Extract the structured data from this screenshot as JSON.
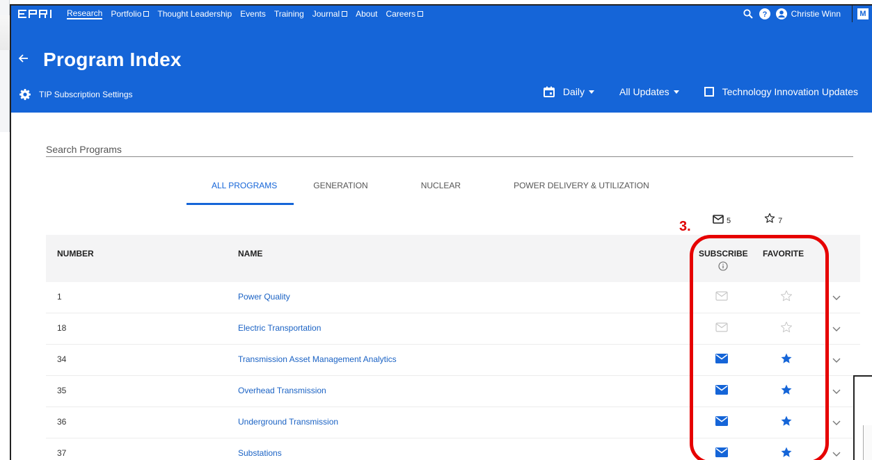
{
  "colors": {
    "brand": "#1565d8",
    "link": "#1a62c4",
    "annotation": "#e60000"
  },
  "nav": {
    "items": [
      {
        "label": "Research",
        "external": false,
        "active": true
      },
      {
        "label": "Portfolio",
        "external": true,
        "active": false
      },
      {
        "label": "Thought Leadership",
        "external": false,
        "active": false
      },
      {
        "label": "Events",
        "external": false,
        "active": false
      },
      {
        "label": "Training",
        "external": false,
        "active": false
      },
      {
        "label": "Journal",
        "external": true,
        "active": false
      },
      {
        "label": "About",
        "external": false,
        "active": false
      },
      {
        "label": "Careers",
        "external": true,
        "active": false
      }
    ],
    "user_name": "Christie Winn",
    "avatar_letter": "M"
  },
  "header": {
    "title": "Program Index",
    "tip_settings": "TIP Subscription Settings",
    "frequency": "Daily",
    "updates": "All Updates",
    "tech_updates": "Technology Innovation Updates"
  },
  "search": {
    "placeholder": "Search Programs"
  },
  "tabs": [
    {
      "label": "ALL PROGRAMS",
      "active": true
    },
    {
      "label": "GENERATION",
      "active": false
    },
    {
      "label": "NUCLEAR",
      "active": false
    },
    {
      "label": "POWER DELIVERY & UTILIZATION",
      "active": false
    }
  ],
  "counts": {
    "subscribe": "5",
    "favorite": "7"
  },
  "table": {
    "headers": {
      "number": "NUMBER",
      "name": "NAME",
      "subscribe": "SUBSCRIBE",
      "favorite": "FAVORITE"
    },
    "rows": [
      {
        "number": "1",
        "name": "Power Quality",
        "subscribed": false,
        "favorited": false
      },
      {
        "number": "18",
        "name": "Electric Transportation",
        "subscribed": false,
        "favorited": false
      },
      {
        "number": "34",
        "name": "Transmission Asset Management Analytics",
        "subscribed": true,
        "favorited": true
      },
      {
        "number": "35",
        "name": "Overhead Transmission",
        "subscribed": true,
        "favorited": true
      },
      {
        "number": "36",
        "name": "Underground Transmission",
        "subscribed": true,
        "favorited": true
      },
      {
        "number": "37",
        "name": "Substations",
        "subscribed": true,
        "favorited": true
      }
    ]
  },
  "annotation": {
    "label": "3."
  }
}
